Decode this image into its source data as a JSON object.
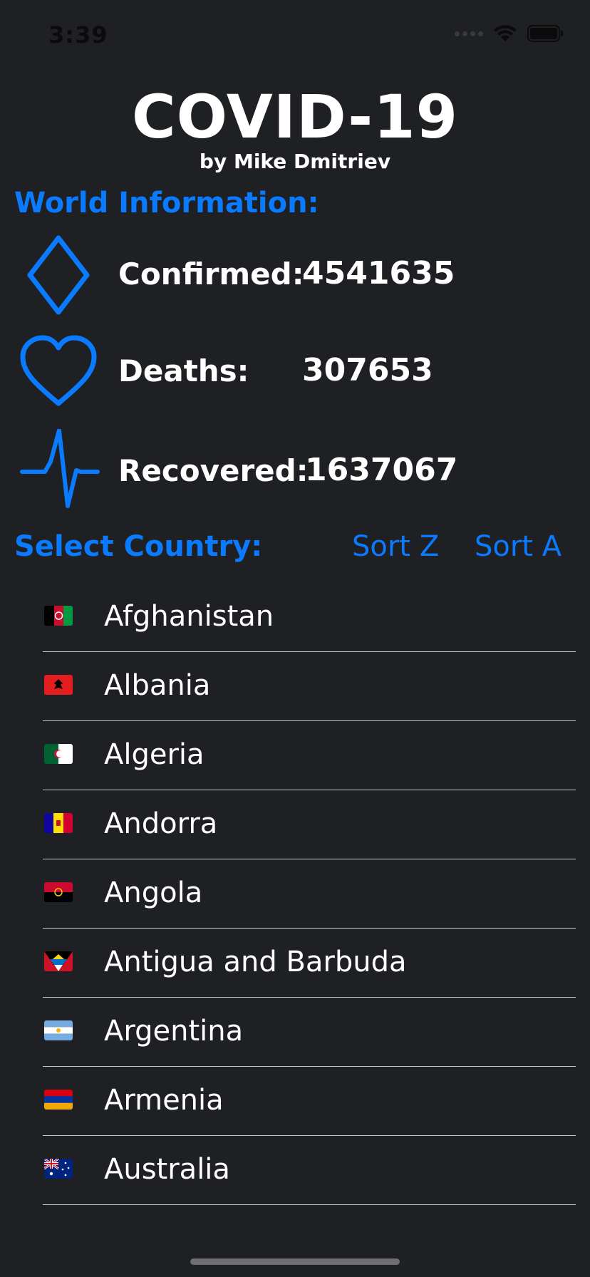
{
  "status_bar": {
    "time": "3:39"
  },
  "header": {
    "title": "COVID-19",
    "subtitle": "by Mike Dmitriev"
  },
  "world_info": {
    "heading": "World Information:",
    "stats": [
      {
        "icon": "diamond-icon",
        "label": "Confirmed:",
        "value": "4541635"
      },
      {
        "icon": "heart-icon",
        "label": "Deaths:",
        "value": "307653"
      },
      {
        "icon": "heartbeat-icon",
        "label": "Recovered:",
        "value": "1637067"
      }
    ]
  },
  "country_section": {
    "heading": "Select Country:",
    "sort_z_label": "Sort Z",
    "sort_a_label": "Sort A"
  },
  "countries": [
    {
      "name": "Afghanistan",
      "flag": "afghanistan-flag-icon"
    },
    {
      "name": "Albania",
      "flag": "albania-flag-icon"
    },
    {
      "name": "Algeria",
      "flag": "algeria-flag-icon"
    },
    {
      "name": "Andorra",
      "flag": "andorra-flag-icon"
    },
    {
      "name": "Angola",
      "flag": "angola-flag-icon"
    },
    {
      "name": "Antigua and Barbuda",
      "flag": "antigua-and-barbuda-flag-icon"
    },
    {
      "name": "Argentina",
      "flag": "argentina-flag-icon"
    },
    {
      "name": "Armenia",
      "flag": "armenia-flag-icon"
    },
    {
      "name": "Australia",
      "flag": "australia-flag-icon"
    }
  ],
  "colors": {
    "background": "#1f2024",
    "accent": "#0a7aff",
    "text": "#ffffff",
    "divider": "#c7c7cc"
  }
}
